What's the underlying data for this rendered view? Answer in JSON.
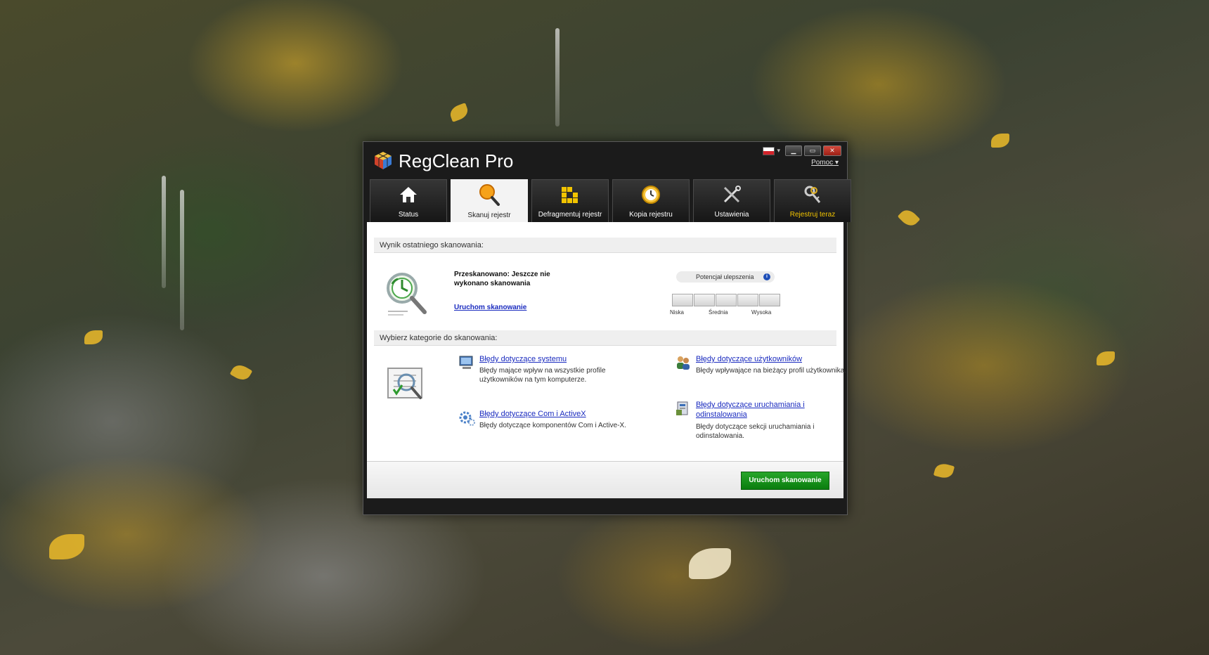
{
  "app": {
    "title": "RegClean Pro",
    "help": "Pomoc",
    "help_arrow": "▾"
  },
  "window_controls": {
    "minimize": "▁",
    "maximize": "▭",
    "close": "✕",
    "flag_arrow": "▾"
  },
  "tabs": [
    {
      "label": "Status",
      "icon": "house-icon",
      "active": false
    },
    {
      "label": "Skanuj rejestr",
      "icon": "magnifier-icon",
      "active": true
    },
    {
      "label": "Defragmentuj rejestr",
      "icon": "blocks-icon",
      "active": false
    },
    {
      "label": "Kopia rejestru",
      "icon": "clock-icon",
      "active": false
    },
    {
      "label": "Ustawienia",
      "icon": "tools-icon",
      "active": false
    },
    {
      "label": "Rejestruj teraz",
      "icon": "keys-icon",
      "active": false
    }
  ],
  "last_scan": {
    "header": "Wynik ostatniego skanowania:",
    "status": "Przeskanowano: Jeszcze nie wykonano skanowania",
    "run_link": "Uruchom skanowanie",
    "potential_label": "Potencjał ulepszenia",
    "info": "i",
    "meter_labels": {
      "low": "Niska",
      "mid": "Średnia",
      "high": "Wysoka"
    }
  },
  "categories": {
    "header": "Wybierz kategorie do skanowania:",
    "items": [
      {
        "title": "Błędy dotyczące systemu",
        "desc": "Błędy mające wpływ na wszystkie profile użytkowników na tym komputerze.",
        "icon": "computer-icon"
      },
      {
        "title": "Błędy dotyczące użytkowników",
        "desc": "Błędy wpływające na bieżący profil użytkownika.",
        "icon": "users-icon"
      },
      {
        "title": "Błędy dotyczące Com i ActiveX",
        "desc": "Błędy dotyczące komponentów Com i Active-X.",
        "icon": "gears-icon"
      },
      {
        "title": "Błędy dotyczące uruchamiania i odinstalowania",
        "desc": "Błędy dotyczące sekcji uruchamiania i odinstalowania.",
        "icon": "installer-icon"
      }
    ]
  },
  "footer": {
    "start_button": "Uruchom skanowanie"
  },
  "colors": {
    "accent_green": "#0f8a12",
    "link_blue": "#1a2bbf",
    "register_yellow": "#f2c400"
  }
}
